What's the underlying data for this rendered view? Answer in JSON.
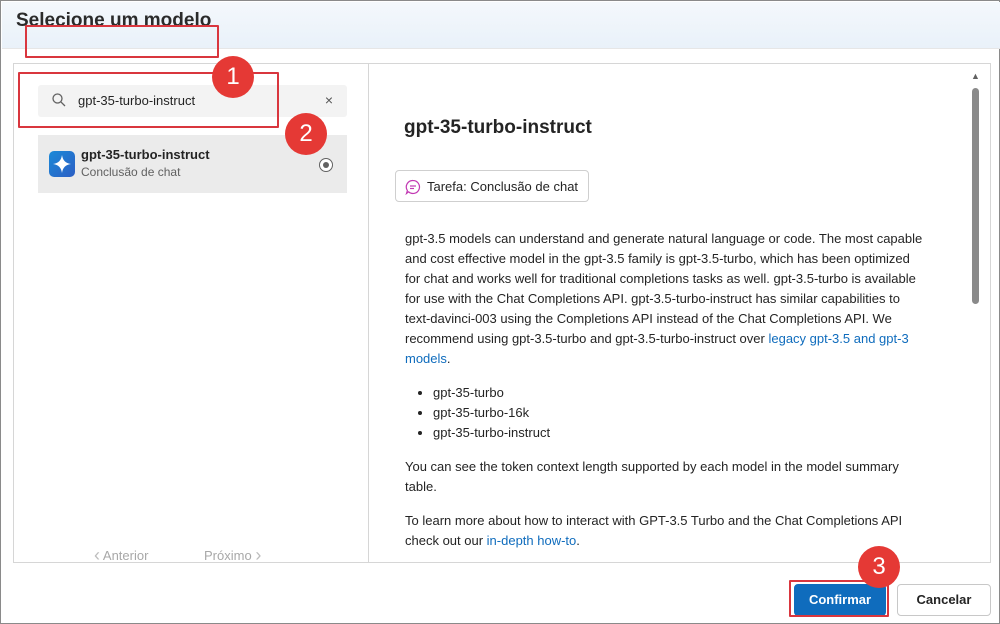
{
  "dialog": {
    "title": "Selecione um modelo"
  },
  "search": {
    "value": "gpt-35-turbo-instruct",
    "clear_label": "×"
  },
  "model_list": [
    {
      "name": "gpt-35-turbo-instruct",
      "task": "Conclusão de chat",
      "selected": true
    }
  ],
  "pager": {
    "prev_label": "Anterior",
    "next_label": "Próximo"
  },
  "detail": {
    "title": "gpt-35-turbo-instruct",
    "task_chip": "Tarefa: Conclusão de chat",
    "para1_text": "gpt-3.5 models can understand and generate natural language or code. The most capable and cost effective model in the gpt-3.5 family is gpt-3.5-turbo, which has been optimized for chat and works well for traditional completions tasks as well. gpt-3.5-turbo is available for use with the Chat Completions API. gpt-3.5-turbo-instruct has similar capabilities to text-davinci-003 using the Completions API instead of the Chat Completions API. We recommend using gpt-3.5-turbo and gpt-3.5-turbo-instruct over ",
    "para1_link": "legacy gpt-3.5 and gpt-3 models",
    "para1_end": ".",
    "bullets": [
      "gpt-35-turbo",
      "gpt-35-turbo-16k",
      "gpt-35-turbo-instruct"
    ],
    "para2": "You can see the token context length supported by each model in the model summary table.",
    "para3_text": "To learn more about how to interact with GPT-3.5 Turbo and the Chat Completions API check out our ",
    "para3_link": "in-depth how-to",
    "para3_end": "."
  },
  "annotations": {
    "step1": "1",
    "step2": "2",
    "step3": "3"
  },
  "footer": {
    "confirm_label": "Confirmar",
    "cancel_label": "Cancelar"
  },
  "colors": {
    "accent": "#0f6cbd",
    "annotation": "#e53935"
  }
}
